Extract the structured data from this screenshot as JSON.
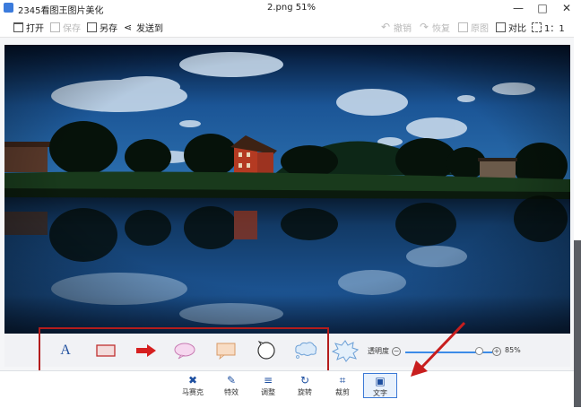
{
  "window": {
    "app_title": "2345看图王图片美化",
    "file_title": "2.png  51%",
    "minimize_glyph": "—",
    "maximize_glyph": "□",
    "close_glyph": "✕"
  },
  "toolbar": {
    "open": "打开",
    "save": "保存",
    "save_as": "另存",
    "share": "发送到",
    "undo": "撤销",
    "redo": "恢复",
    "compare_original": "原图",
    "contrast": "对比",
    "ratio": "1：1"
  },
  "shapes": {
    "text_tool_glyph": "A",
    "items": [
      "text-tool",
      "rectangle",
      "arrow",
      "ellipse-bubble",
      "rect-bubble",
      "round-bubble",
      "cloud-bubble",
      "burst-bubble"
    ]
  },
  "opacity": {
    "label": "透明度",
    "minus": "−",
    "plus": "+",
    "value_text": "85%",
    "value": 0.85
  },
  "bottom_tools": {
    "mosaic": "马赛克",
    "effects": "特效",
    "adjust": "调整",
    "rotate": "旋转",
    "crop": "裁剪",
    "text": "文字"
  },
  "colors": {
    "annotation_red": "#b41c1c",
    "accent_blue": "#3b79d6"
  }
}
